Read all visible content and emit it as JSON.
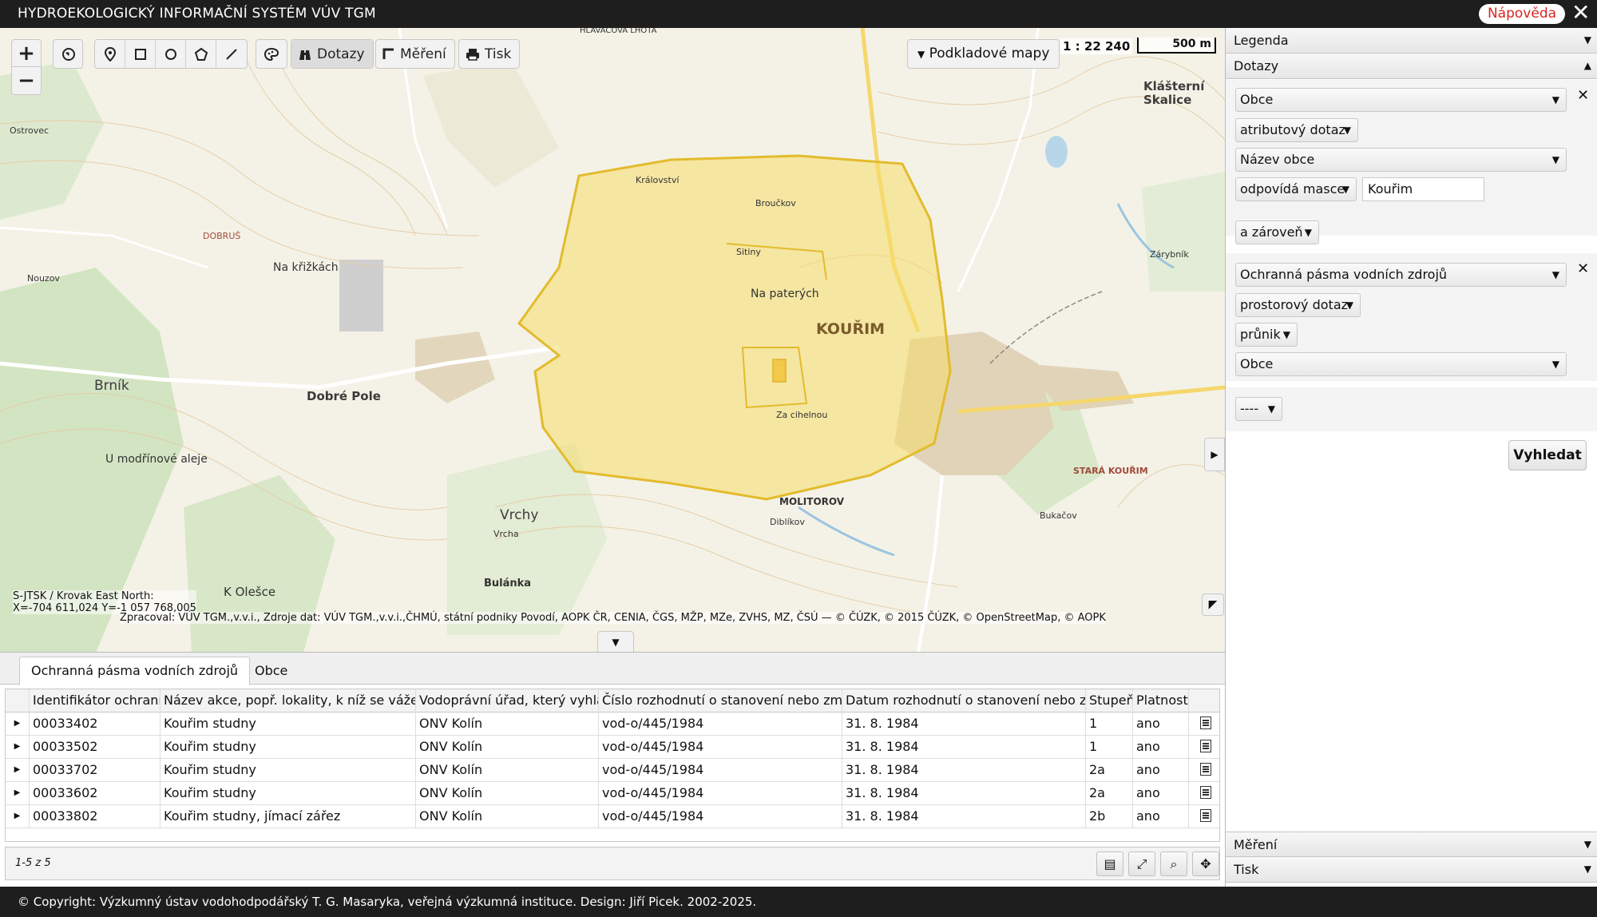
{
  "app": {
    "title": "HYDROEKOLOGICKÝ INFORMAČNÍ SYSTÉM VÚV TGM",
    "help_label": "Nápověda",
    "close_glyph": "✕"
  },
  "map": {
    "zoom_in": "+",
    "zoom_out": "−",
    "toolbar": {
      "queries_label": "Dotazy",
      "measure_label": "Měření",
      "print_label": "Tisk"
    },
    "basemaps_label": "Podkladové mapy",
    "scale_ratio": "1 : 22 240",
    "scale_bar": "500 m",
    "coords_line1": "S-JTSK / Krovak East North:",
    "coords_line2": "X=-704 611,024 Y=-1 057 768,005",
    "attribution": "Zpracoval: VÚV TGM.,v.v.i., Zdroje dat: VÚV TGM.,v.v.i.,ČHMÚ, státní podniky Povodí, AOPK ČR, CENIA, ČGS, MŽP, MZe, ZVHS, MZ, ČSÚ — © ČÚZK, © 2015 ČÚZK, © OpenStreetMap, © AOPK",
    "labels": {
      "kourim": "KOUŘIM",
      "dobre_pole": "Dobré Pole",
      "brnik": "Brník",
      "vrchy": "Vrchy",
      "bulanka": "Bulánka",
      "klasterni_skalice": "Klášterní Skalice",
      "molitorov": "MOLITOROV",
      "na_paterych": "Na paterých",
      "na_krizkach": "Na křižkách",
      "u_modrinove_aleje": "U modřínové aleje",
      "k_olesce": "K Olešce",
      "stara_kourim": "STARÁ KOUŘIM",
      "kralovstvi": "Království",
      "ostrovec": "Ostrovec",
      "dobrus": "DOBRUŠ",
      "zarybnik": "Zárybník",
      "za_cihelnou": "Za cihelnou",
      "brouckov": "Broučkov",
      "sitiny": "Sitiny",
      "hlavacova_lhota": "HLAVÁČOVA LHOTA",
      "vrcha": "Vrcha",
      "nouzov": "Nouzov",
      "diblikov": "Diblíkov",
      "bukacov": "Bukačov"
    }
  },
  "panel": {
    "legend_label": "Legenda",
    "queries_label": "Dotazy",
    "q1": {
      "layer": "Obce",
      "type": "atributový dotaz",
      "attribute": "Název obce",
      "operator": "odpovídá masce",
      "value": "Kouřim"
    },
    "conj": "a zároveň",
    "q2": {
      "layer": "Ochranná pásma vodních zdrojů",
      "type": "prostorový dotaz",
      "relation": "průnik",
      "target": "Obce"
    },
    "extra": "----",
    "search_label": "Vyhledat",
    "measure_label": "Měření",
    "print_label": "Tisk",
    "remove_glyph": "✕"
  },
  "results": {
    "tabs": [
      "Ochranná pásma vodních zdrojů",
      "Obce"
    ],
    "columns": [
      "Identifikátor ochranného pásma",
      "Název akce, popř. lokality, k níž se váže vodní zdroj",
      "Vodoprávní úřad, který vyhlásil",
      "Číslo rozhodnutí o stanovení nebo změně",
      "Datum rozhodnutí o stanovení nebo změně",
      "Stupeň",
      "Platnost"
    ],
    "rows": [
      {
        "id": "00033402",
        "name": "Kouřim studny",
        "office": "ONV Kolín",
        "decision": "vod-o/445/1984",
        "date": "31. 8. 1984",
        "level": "1",
        "valid": "ano"
      },
      {
        "id": "00033502",
        "name": "Kouřim studny",
        "office": "ONV Kolín",
        "decision": "vod-o/445/1984",
        "date": "31. 8. 1984",
        "level": "1",
        "valid": "ano"
      },
      {
        "id": "00033702",
        "name": "Kouřim studny",
        "office": "ONV Kolín",
        "decision": "vod-o/445/1984",
        "date": "31. 8. 1984",
        "level": "2a",
        "valid": "ano"
      },
      {
        "id": "00033602",
        "name": "Kouřim studny",
        "office": "ONV Kolín",
        "decision": "vod-o/445/1984",
        "date": "31. 8. 1984",
        "level": "2a",
        "valid": "ano"
      },
      {
        "id": "00033802",
        "name": "Kouřim studny, jímací zářez",
        "office": "ONV Kolín",
        "decision": "vod-o/445/1984",
        "date": "31. 8. 1984",
        "level": "2b",
        "valid": "ano"
      }
    ],
    "pager_info": "1-5 z 5"
  },
  "footer": {
    "text": "© Copyright: Výzkumný ústav vodohodpodářský T. G. Masaryka, veřejná výzkumná instituce. Design: Jiří Picek. 2002-2025."
  },
  "colors": {
    "accent_red": "#d8241f",
    "dark_bar": "#1e1e1e",
    "polygon_fill": "#f6dc6a",
    "polygon_stroke": "#e3bb2c"
  }
}
